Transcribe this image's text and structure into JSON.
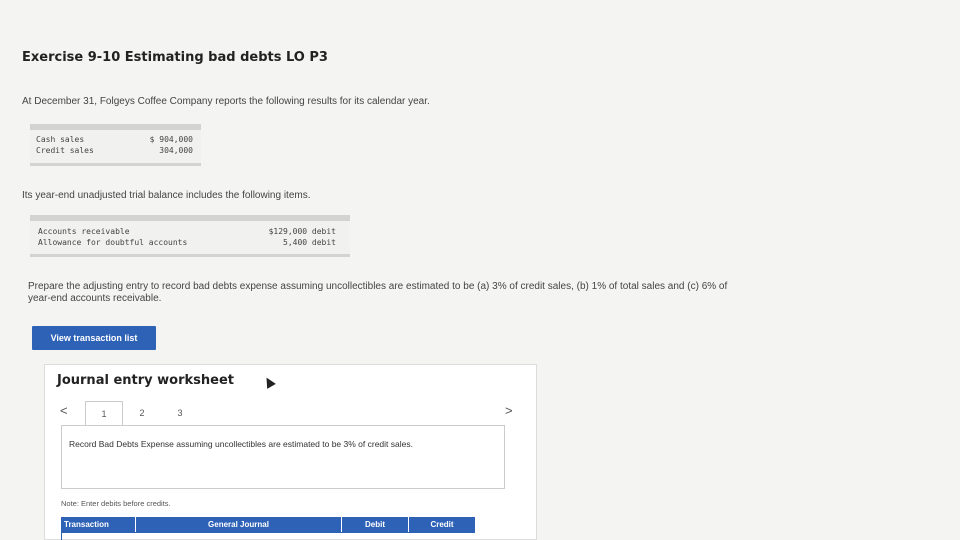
{
  "exercise_title": "Exercise 9-10 Estimating bad debts LO P3",
  "intro_text": "At December 31, Folgeys Coffee Company reports the following results for its calendar year.",
  "sales_table": [
    {
      "label": "Cash sales",
      "value": "$ 904,000"
    },
    {
      "label": "Credit sales",
      "value": "304,000"
    }
  ],
  "trial_balance_intro": "Its year-end unadjusted trial balance includes the following items.",
  "trial_balance_table": [
    {
      "label": "Accounts receivable",
      "value": "$129,000 debit"
    },
    {
      "label": "Allowance for doubtful accounts",
      "value": "5,400 debit"
    }
  ],
  "prepare_text": "Prepare the adjusting entry to record bad debts expense assuming uncollectibles are estimated to be (a) 3% of credit sales, (b) 1% of total sales and (c) 6% of year-end accounts receivable.",
  "view_button_label": "View transaction list",
  "worksheet": {
    "title": "Journal entry worksheet",
    "prev_icon": "chevron-left-icon",
    "next_icon": "chevron-right-icon",
    "prev_glyph": "<",
    "next_glyph": ">",
    "steps": [
      "1",
      "2",
      "3"
    ],
    "active_step": "1",
    "instruction": "Record Bad Debts Expense assuming uncollectibles are estimated to be 3% of credit sales.",
    "note": "Note: Enter debits before credits.",
    "columns": [
      "Transaction",
      "General Journal",
      "Debit",
      "Credit"
    ]
  },
  "colors": {
    "accent": "#2e62b6",
    "table_bg": "#f1f1ef",
    "table_border": "#d3d3d1"
  }
}
